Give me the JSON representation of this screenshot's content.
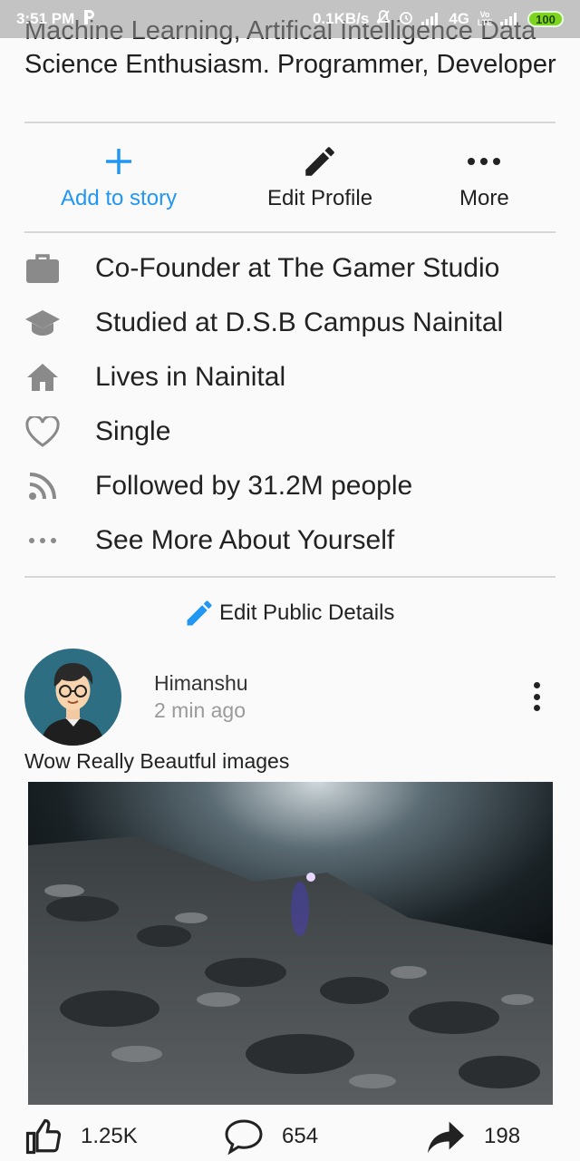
{
  "status_bar": {
    "time": "3:51 PM",
    "network_speed": "0.1KB/s",
    "network_type": "4G",
    "volte": "Vo LTE",
    "battery": "100"
  },
  "profile": {
    "bio": "Machine Learning, Artifical Intelligence Data Science Enthusiasm. Programmer, Developer"
  },
  "actions": {
    "add_story": "Add to story",
    "edit_profile": "Edit Profile",
    "more": "More"
  },
  "info": {
    "work": "Co-Founder at The Gamer Studio",
    "education": "Studied at D.S.B Campus Nainital",
    "home": "Lives in Nainital",
    "relationship": "Single",
    "followers": "Followed by 31.2M people",
    "see_more": "See More About Yourself"
  },
  "edit_public_details": "Edit Public Details",
  "post": {
    "author": "Himanshu",
    "time": "2 min ago",
    "caption": "Wow Really Beautful images",
    "likes": "1.25K",
    "comments": "654",
    "shares": "198"
  },
  "colors": {
    "accent": "#2196f3",
    "icon_gray": "#8a8a8a",
    "avatar_bg": "#2e6e82"
  }
}
